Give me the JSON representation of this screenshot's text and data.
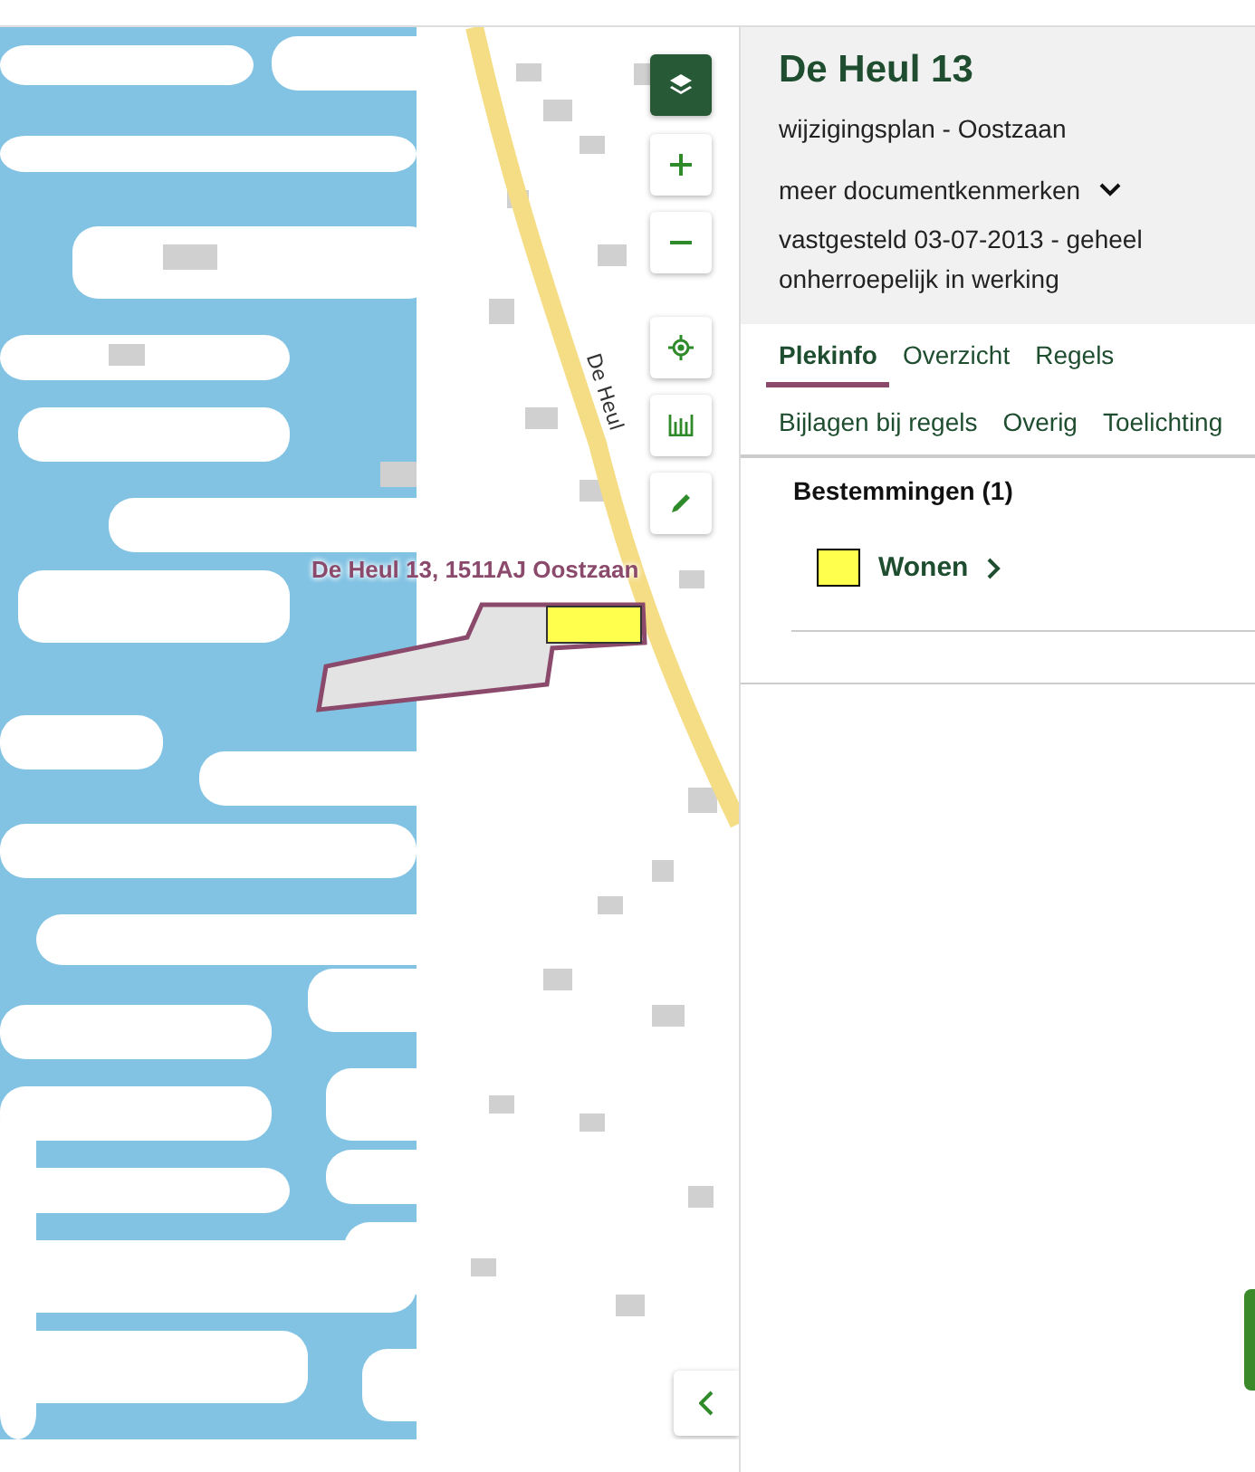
{
  "map": {
    "road_label": "De Heul",
    "address_label": "De Heul 13, 1511AJ Oostzaan"
  },
  "panel": {
    "title": "De Heul 13",
    "subtitle": "wijzigingsplan - Oostzaan",
    "more": {
      "label": "meer documentkenmerken",
      "expanded": false
    },
    "status": "vastgesteld 03-07-2013 - geheel onherroepelijk in werking"
  },
  "tabs": [
    {
      "label": "Plekinfo",
      "selected": true
    },
    {
      "label": "Overzicht",
      "selected": false
    },
    {
      "label": "Regels",
      "selected": false
    },
    {
      "label": "Bijlagen bij regels",
      "selected": false
    },
    {
      "label": "Overig",
      "selected": false
    },
    {
      "label": "Toelichting",
      "selected": false
    }
  ],
  "section": {
    "title": "Bestemmingen (1)",
    "items": [
      {
        "label": "Wonen",
        "color": "#ffff4d"
      }
    ]
  }
}
